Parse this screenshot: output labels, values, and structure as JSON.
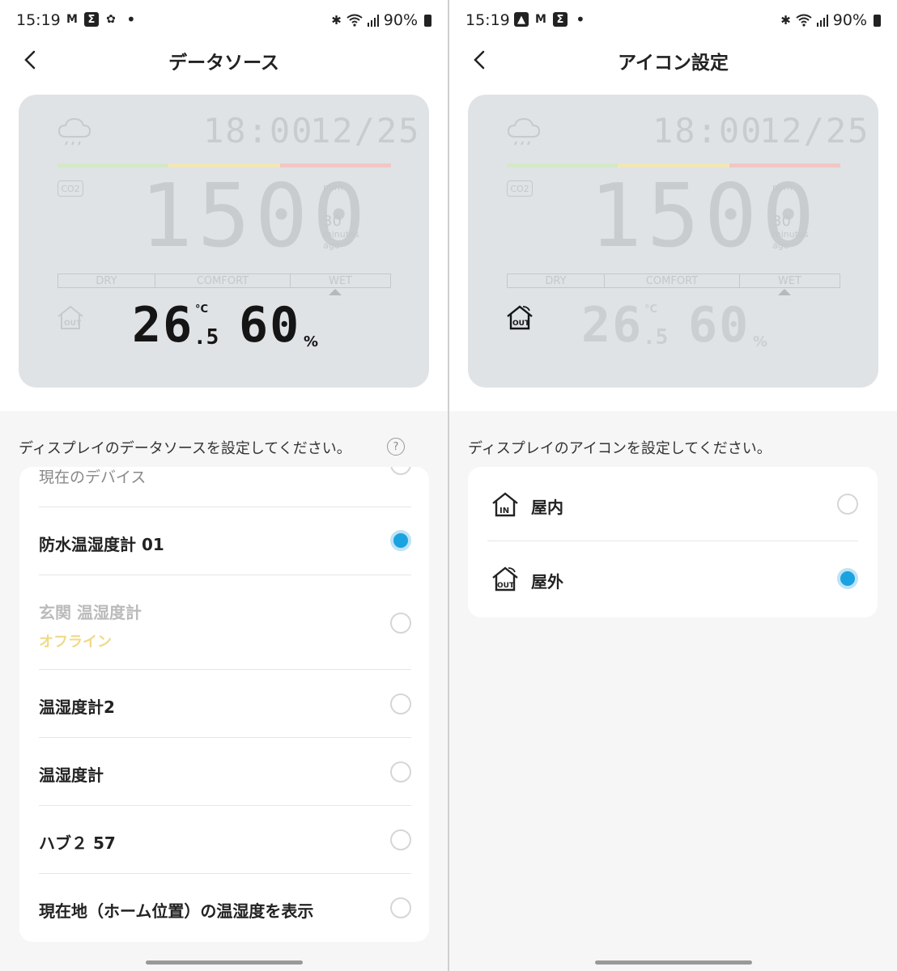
{
  "status_left": {
    "time": "15:19",
    "battery": "90%",
    "notifications": [
      "gmail-icon",
      "sigma-app-icon",
      "android-settings-icon"
    ]
  },
  "status_right": {
    "time": "15:19",
    "battery": "90%",
    "notifications": [
      "gallery-icon",
      "gmail-icon",
      "sigma-app-icon"
    ]
  },
  "left": {
    "title": "データソース",
    "description": "ディスプレイのデータソースを設定してください。",
    "help": "?",
    "options": [
      {
        "label": "現在のデバイス",
        "selected": false,
        "partial": true
      },
      {
        "label": "防水温湿度計 01",
        "selected": true
      },
      {
        "label": "玄関 温湿度計",
        "sublabel": "オフライン",
        "selected": false,
        "disabled": true
      },
      {
        "label": "温湿度計2",
        "selected": false
      },
      {
        "label": "温湿度計",
        "selected": false
      },
      {
        "label": "ハブ２ 57",
        "selected": false
      },
      {
        "label": "現在地（ホーム位置）の温湿度を表示",
        "selected": false
      }
    ]
  },
  "right": {
    "title": "アイコン設定",
    "description": "ディスプレイのアイコンを設定してください。",
    "options": [
      {
        "label": "屋内",
        "icon": "house-in-icon",
        "selected": false
      },
      {
        "label": "屋外",
        "icon": "house-out-icon",
        "selected": true
      }
    ]
  },
  "lcd": {
    "clock": "18:00",
    "date": "12/25",
    "co2_value": "1500",
    "co2_badge": "CO2",
    "unit_ppm": "ppm",
    "ago_value": "30",
    "ago_line1": "minutes",
    "ago_line2": "ago",
    "comfort_labels": [
      "DRY",
      "COMFORT",
      "WET"
    ],
    "temp_int": "26",
    "temp_dec": ".5",
    "temp_unit": "°C",
    "humidity": "60",
    "humidity_unit": "%",
    "out_label": "OUT",
    "colors": {
      "green": "#d5e8c8",
      "yellow": "#f1e7b6",
      "red": "#f2c6c4"
    }
  }
}
